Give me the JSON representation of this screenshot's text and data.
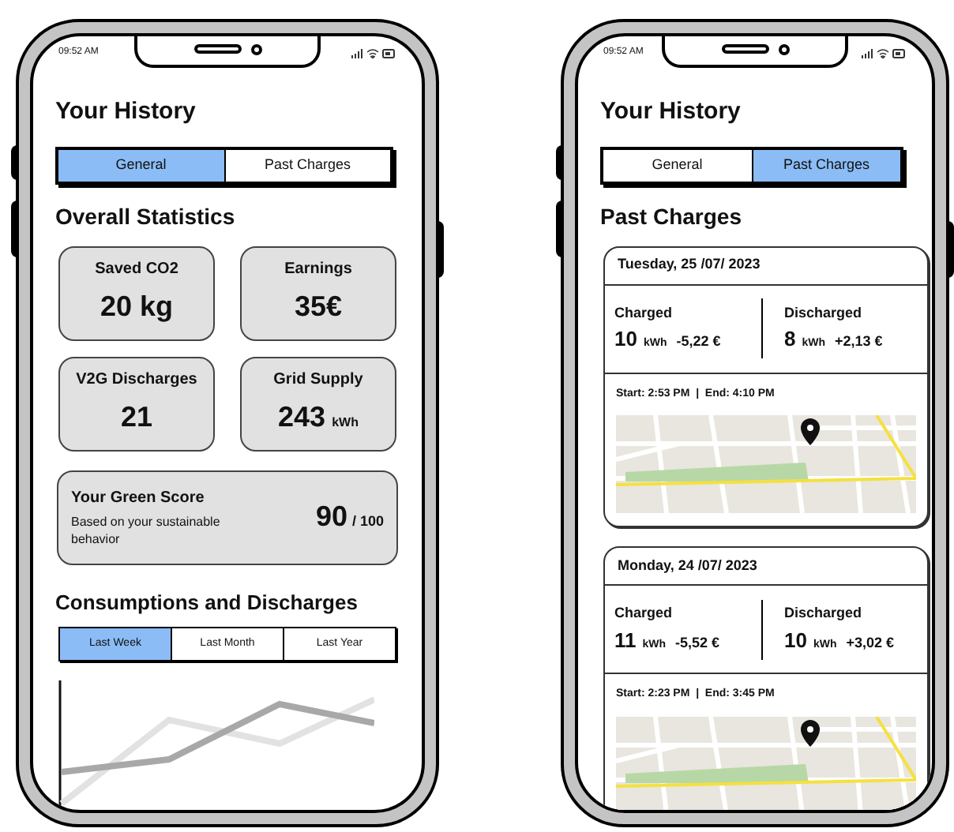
{
  "phones": [
    {
      "kind": "general",
      "status_bar": {
        "time": "09:52 AM"
      },
      "title": "Your History",
      "tabs": [
        {
          "label": "General",
          "selected": true
        },
        {
          "label": "Past Charges",
          "selected": false
        }
      ],
      "section_title": "Overall Statistics",
      "stats": [
        {
          "label": "Saved CO2",
          "value": "20 kg"
        },
        {
          "label": "Earnings",
          "value": "35€"
        },
        {
          "label": "V2G Discharges",
          "value": "21"
        },
        {
          "label": "Grid Supply",
          "value": "243",
          "unit": "kWh"
        }
      ],
      "green_score": {
        "title": "Your Green Score",
        "description": "Based on your sustainable behavior",
        "score": "90",
        "max": "/ 100"
      },
      "chart_section": {
        "title": "Consumptions and Discharges",
        "ranges": [
          {
            "label": "Last Week",
            "selected": true
          },
          {
            "label": "Last Month",
            "selected": false
          },
          {
            "label": "Last Year",
            "selected": false
          }
        ]
      }
    },
    {
      "kind": "past_charges",
      "status_bar": {
        "time": "09:52 AM"
      },
      "title": "Your History",
      "tabs": [
        {
          "label": "General",
          "selected": false
        },
        {
          "label": "Past Charges",
          "selected": true
        }
      ],
      "section_title": "Past Charges",
      "charges": [
        {
          "date": "Tuesday, 25 /07/ 2023",
          "charged": {
            "label": "Charged",
            "amount": "10",
            "unit": "kWh",
            "cost": "-5,22 €"
          },
          "discharged": {
            "label": "Discharged",
            "amount": "8",
            "unit": "kWh",
            "cost": "+2,13 €"
          },
          "times": "Start: 2:53 PM  |  End: 4:10 PM"
        },
        {
          "date": "Monday, 24 /07/ 2023",
          "charged": {
            "label": "Charged",
            "amount": "11",
            "unit": "kWh",
            "cost": "-5,52 €"
          },
          "discharged": {
            "label": "Discharged",
            "amount": "10",
            "unit": "kWh",
            "cost": "+3,02 €"
          },
          "times": "Start: 2:23 PM  |  End: 3:45 PM"
        }
      ]
    }
  ]
}
